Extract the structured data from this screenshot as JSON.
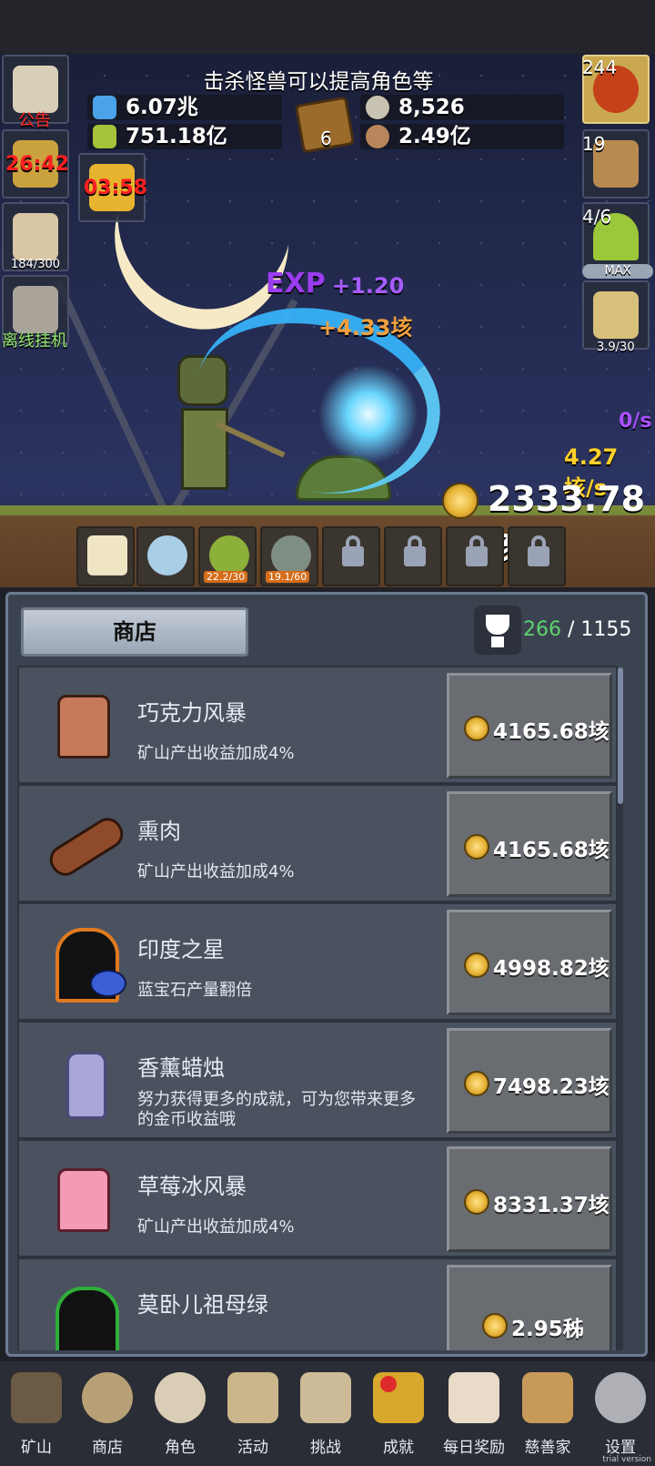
{
  "hud": {
    "hint": "击杀怪兽可以提高角色等",
    "resources": {
      "potion_blue": "6.07兆",
      "potion_green": "751.18亿",
      "silver": "8,526",
      "meat": "2.49亿",
      "book_count": "6"
    },
    "left_buttons": {
      "notice_label": "公告",
      "torch_timer": "26:42",
      "bucket_timer": "03:58",
      "drink_progress": "184/300",
      "offline_label": "离线挂机"
    },
    "right_buttons": {
      "potion_count": "244",
      "chest_count": "19",
      "slime_progress": "4/6",
      "slime_max": "MAX",
      "sword_progress": "3.9/30"
    },
    "floating": {
      "exp_label": "EXP",
      "exp_gain": "+1.20",
      "gold_gain": "+4.33垓"
    },
    "rates": {
      "rate1": "0/s",
      "rate2": "4.27垓/s"
    },
    "gold_total": "2333.78垓",
    "pets": [
      {
        "name": "candle-pet",
        "label": ""
      },
      {
        "name": "egg-pet",
        "label": ""
      },
      {
        "name": "slime-pet",
        "label": "22.2/30"
      },
      {
        "name": "zombie-pet",
        "label": "19.1/60"
      }
    ]
  },
  "shop": {
    "tab_label": "商店",
    "trophy_current": "266",
    "trophy_separator": " / ",
    "trophy_total": "1155",
    "items": [
      {
        "name": "巧克力风暴",
        "desc": "矿山产出收益加成4%",
        "price": "4165.68垓",
        "icon_color": "#c77a5a"
      },
      {
        "name": "熏肉",
        "desc": "矿山产出收益加成4%",
        "price": "4165.68垓",
        "icon_color": "#8e4a2a"
      },
      {
        "name": "印度之星",
        "desc": "蓝宝石产量翻倍",
        "price": "4998.82垓",
        "icon_color": "#e07a20"
      },
      {
        "name": "香薰蜡烛",
        "desc": "努力获得更多的成就，可为您带来更多的金币收益哦",
        "price": "7498.23垓",
        "icon_color": "#a9a6d8"
      },
      {
        "name": "草莓冰风暴",
        "desc": "矿山产出收益加成4%",
        "price": "8331.37垓",
        "icon_color": "#f39ab4"
      },
      {
        "name": "莫卧儿祖母绿",
        "desc": "",
        "price": "2.95秭",
        "icon_color": "#2fae3a"
      }
    ]
  },
  "nav": {
    "items": [
      {
        "label": "矿山",
        "icon": "lantern-icon",
        "color": "#6b5a44"
      },
      {
        "label": "商店",
        "icon": "ore-icon",
        "color": "#b7a076"
      },
      {
        "label": "角色",
        "icon": "skull-icon",
        "color": "#d9cdb5"
      },
      {
        "label": "活动",
        "icon": "scroll-icon",
        "color": "#cbb58a"
      },
      {
        "label": "挑战",
        "icon": "map-icon",
        "color": "#cdbb98"
      },
      {
        "label": "成就",
        "icon": "key-icon",
        "color": "#d7a82c"
      },
      {
        "label": "每日奖励",
        "icon": "letter-icon",
        "color": "#e9dbc7"
      },
      {
        "label": "慈善家",
        "icon": "bread-icon",
        "color": "#c89a5a"
      },
      {
        "label": "设置",
        "icon": "gear-icon",
        "color": "#aeb0b6"
      }
    ],
    "trial": "trial version"
  }
}
